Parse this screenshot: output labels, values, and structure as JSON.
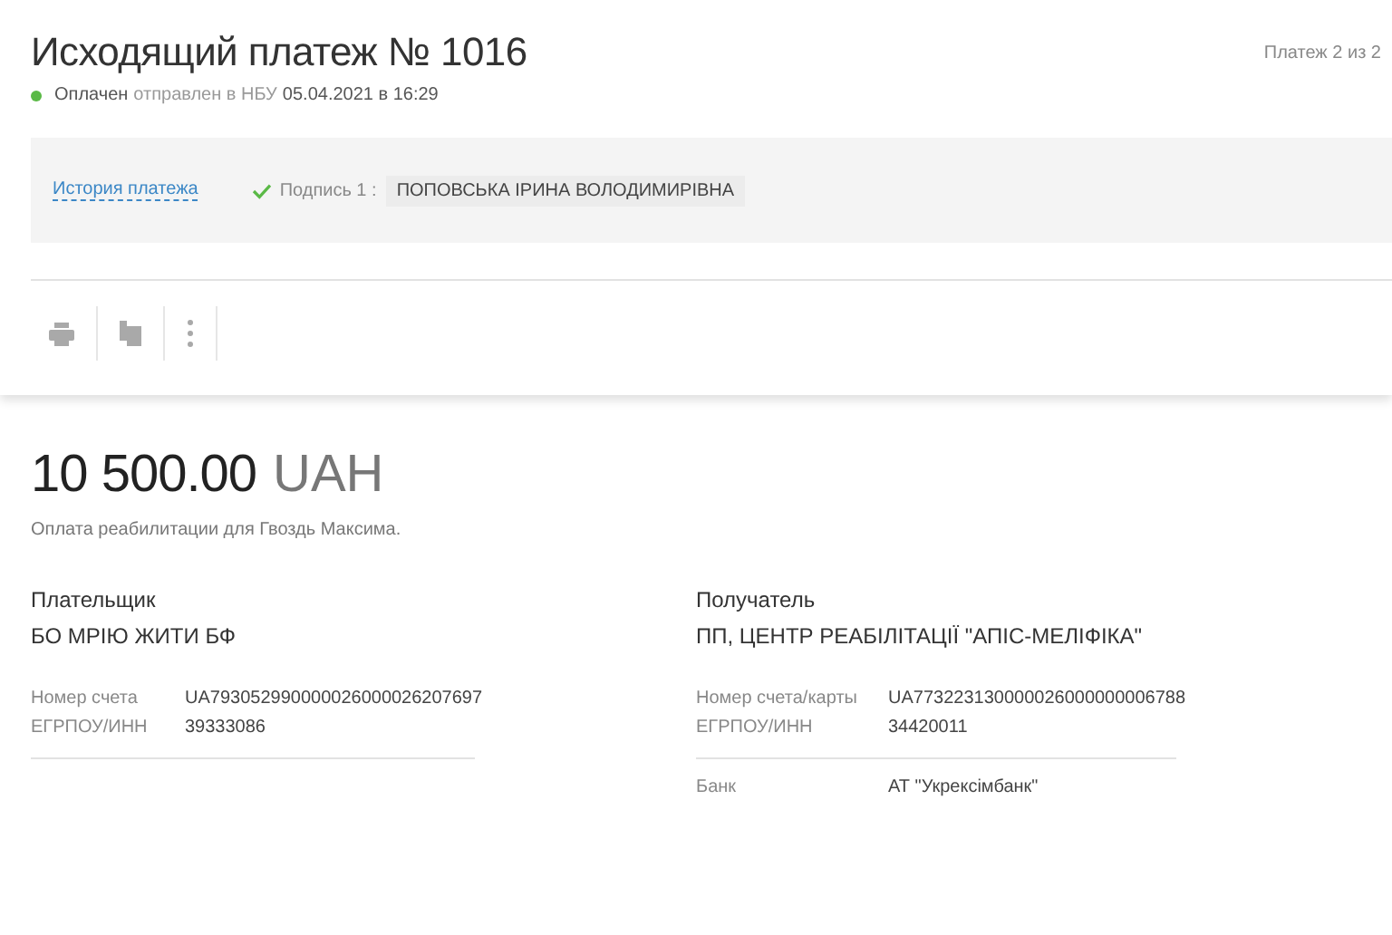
{
  "title": "Исходящий платеж № 1016",
  "counter": "Платеж 2 из 2",
  "status": {
    "color": "#5ab946",
    "label": "Оплачен",
    "text": "отправлен в НБУ",
    "date": "05.04.2021 в 16:29"
  },
  "history_link": "История платежа",
  "signature": {
    "signed": true,
    "label": "Подпись 1 :",
    "name": "ПОПОВСЬКА ІРИНА ВОЛОДИМИРІВНА"
  },
  "amount": {
    "value": "10 500.00",
    "currency": "UAH"
  },
  "purpose": "Оплата реабилитации для Гвоздь Максима.",
  "parties": [
    {
      "heading": "Плательщик",
      "name": "БО МРІЮ ЖИТИ БФ",
      "groups": [
        [
          {
            "label": "Номер счета",
            "value": "UA793052990000026000026207697"
          },
          {
            "label": "ЕГРПОУ/ИНН",
            "value": "39333086"
          }
        ]
      ]
    },
    {
      "heading": "Получатель",
      "name": "ПП, ЦЕНТР РЕАБІЛІТАЦІЇ \"АПІС-МЕЛІФІКА\"",
      "groups": [
        [
          {
            "label": "Номер счета/карты",
            "value": "UA773223130000026000000006788"
          },
          {
            "label": "ЕГРПОУ/ИНН",
            "value": "34420011"
          }
        ],
        [
          {
            "label": "Банк",
            "value": "АТ \"Укрексімбанк\""
          }
        ]
      ]
    }
  ]
}
